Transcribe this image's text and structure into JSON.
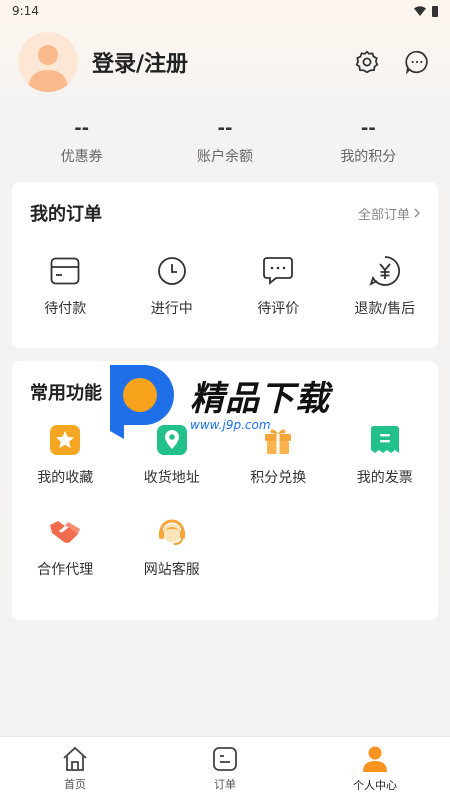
{
  "status_bar": {
    "time": "9:14"
  },
  "profile": {
    "login_label": "登录/注册"
  },
  "stats": [
    {
      "value": "--",
      "label": "优惠券"
    },
    {
      "value": "--",
      "label": "账户余额"
    },
    {
      "value": "--",
      "label": "我的积分"
    }
  ],
  "orders": {
    "title": "我的订单",
    "more_label": "全部订单",
    "items": [
      {
        "label": "待付款",
        "icon": "wallet-card-icon"
      },
      {
        "label": "进行中",
        "icon": "clock-icon"
      },
      {
        "label": "待评价",
        "icon": "chat-dots-icon"
      },
      {
        "label": "退款/售后",
        "icon": "yuan-refund-icon"
      }
    ]
  },
  "common": {
    "title": "常用功能",
    "items": [
      {
        "label": "我的收藏",
        "icon": "star-icon",
        "color": "#f5a623"
      },
      {
        "label": "收货地址",
        "icon": "location-pin-icon",
        "color": "#22c08a"
      },
      {
        "label": "积分兑换",
        "icon": "gift-icon",
        "color": "#f7a43a"
      },
      {
        "label": "我的发票",
        "icon": "invoice-icon",
        "color": "#22c08a"
      },
      {
        "label": "合作代理",
        "icon": "handshake-icon",
        "color": "#f26b4f"
      },
      {
        "label": "网站客服",
        "icon": "headset-icon",
        "color": "#f7a43a"
      }
    ]
  },
  "watermark": {
    "title": "精品下载",
    "url": "www.j9p.com"
  },
  "tabbar": [
    {
      "label": "首页",
      "icon": "home-icon"
    },
    {
      "label": "订单",
      "icon": "order-icon"
    },
    {
      "label": "个人中心",
      "icon": "user-icon",
      "active": true
    }
  ],
  "colors": {
    "accent": "#f7931e",
    "green": "#22c08a"
  }
}
